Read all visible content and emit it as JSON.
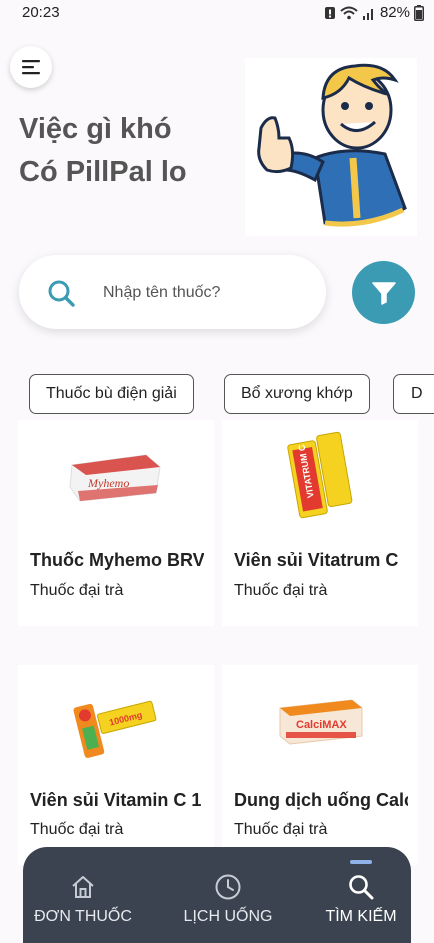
{
  "status": {
    "time": "20:23",
    "battery": "82%"
  },
  "header": {
    "line1": "Việc gì khó",
    "line2": "Có PillPal lo",
    "mascot": "vault-boy-thumbs-up"
  },
  "search": {
    "placeholder": "Nhập tên thuốc?"
  },
  "chips": [
    "Thuốc bù điện giải",
    "Bổ xương khớp",
    "D"
  ],
  "products": [
    {
      "name": "Thuốc Myhemo BRV",
      "type": "Thuốc đại trà"
    },
    {
      "name": "Viên sủi Vitatrum C",
      "type": "Thuốc đại trà"
    },
    {
      "name": "Viên sủi Vitamin C 1",
      "type": "Thuốc đại trà"
    },
    {
      "name": "Dung dịch uống Calc",
      "type": "Thuốc đại trà"
    }
  ],
  "product_images": {
    "p1": "Myhemo",
    "p2": "VITATRUM C",
    "p3": "1000mg",
    "p4": "CalciMAX"
  },
  "nav": [
    {
      "label": "ĐƠN THUỐC",
      "icon": "home-icon",
      "active": false
    },
    {
      "label": "LỊCH UỐNG",
      "icon": "clock-icon",
      "active": false
    },
    {
      "label": "TÌM KIẾM",
      "icon": "search-icon",
      "active": true
    }
  ],
  "colors": {
    "accent": "#3a9bb3",
    "nav_bg": "#3b4350",
    "indicator": "#8fb3e8"
  }
}
